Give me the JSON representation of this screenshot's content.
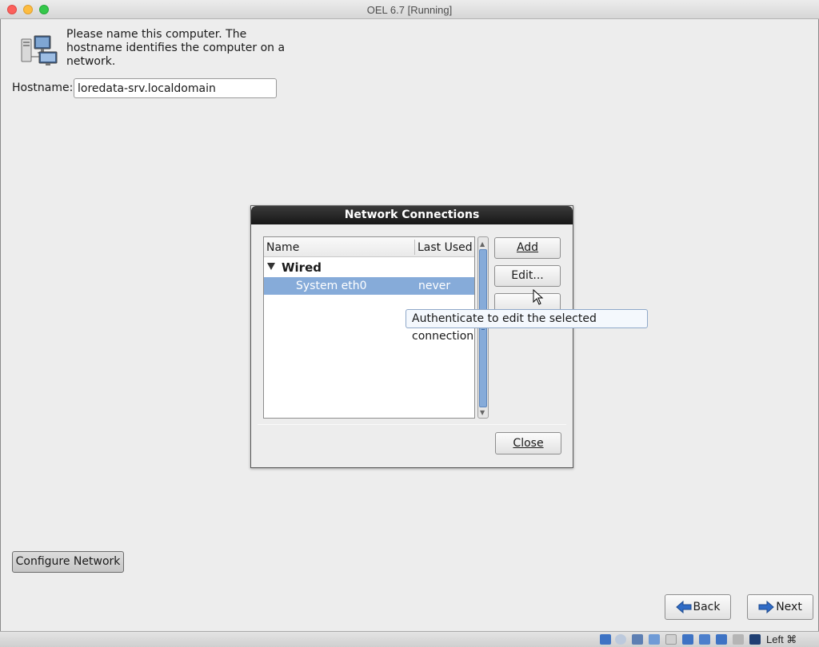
{
  "window": {
    "title": "OEL 6.7 [Running]"
  },
  "intro": {
    "text": "Please name this computer.  The hostname identifies the computer on a network."
  },
  "hostname": {
    "label": "Hostname:",
    "value": "loredata-srv.localdomain"
  },
  "dialog": {
    "title": "Network Connections",
    "columns": {
      "name": "Name",
      "last_used": "Last Used"
    },
    "group": "Wired",
    "connection": {
      "name": "System eth0",
      "last_used": "never"
    },
    "buttons": {
      "add": "Add",
      "edit": "Edit...",
      "close": "Close"
    },
    "tooltip": "Authenticate to edit the selected connection"
  },
  "footer": {
    "configure_network": "Configure Network",
    "back": "Back",
    "next": "Next"
  },
  "statusbar": {
    "host_key": "Left ⌘"
  },
  "colors": {
    "selection": "#86abd9",
    "tooltip_bg": "#f4f8fd",
    "arrow_blue": "#2f6bc6"
  }
}
